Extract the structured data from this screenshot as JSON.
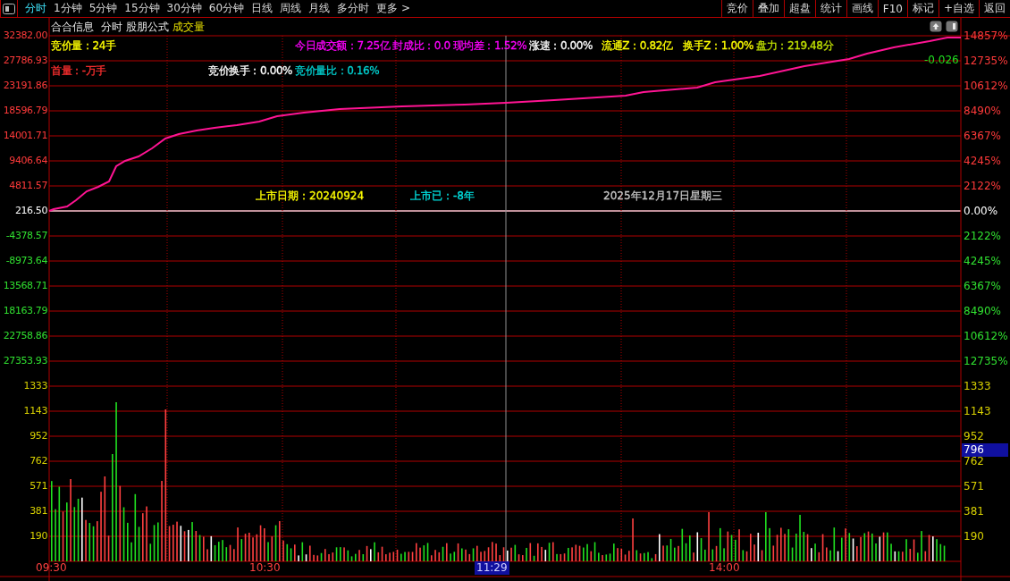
{
  "toolbar": {
    "tabs": [
      {
        "label": "分时",
        "selected": true
      },
      {
        "label": "1分钟",
        "selected": false
      },
      {
        "label": "5分钟",
        "selected": false
      },
      {
        "label": "15分钟",
        "selected": false
      },
      {
        "label": "30分钟",
        "selected": false
      },
      {
        "label": "60分钟",
        "selected": false
      },
      {
        "label": "日线",
        "selected": false
      },
      {
        "label": "周线",
        "selected": false
      },
      {
        "label": "月线",
        "selected": false
      },
      {
        "label": "多分时",
        "selected": false
      },
      {
        "label": "更多 >",
        "selected": false
      }
    ],
    "buttons": [
      "竞价",
      "叠加",
      "超盘",
      "统计",
      "画线",
      "F10",
      "标记",
      "+自选",
      "返回"
    ]
  },
  "chart_header": {
    "stock": "合合信息",
    "items": [
      {
        "label": "分时",
        "kind": "normal"
      },
      {
        "label": "股朋公式",
        "kind": "normal"
      },
      {
        "label": "成交量",
        "kind": "indicator"
      }
    ]
  },
  "info_row_1": [
    {
      "text": "竞价量：24手",
      "color": "#ffff00"
    },
    {
      "text": "今日成交额：7.25亿",
      "color": "#ff00ff"
    },
    {
      "text": "封成比：0.0",
      "color": "#ff00ff"
    },
    {
      "text": "现均差：1.52%",
      "color": "#ff00ff"
    },
    {
      "text": "涨速：0.00%",
      "color": "#ffffff"
    },
    {
      "text": "流通Z：0.82亿",
      "color": "#ffff00"
    },
    {
      "text": "换手Z：1.00%",
      "color": "#ffff00"
    },
    {
      "text": "盘力：219.48分",
      "color": "#c0e000"
    }
  ],
  "info_row_2": [
    {
      "text": "首量：-万手",
      "color": "#ff3030"
    },
    {
      "text": "竞价换手：0.00%",
      "color": "#ffffff"
    },
    {
      "text": "竞价量比：0.16%",
      "color": "#00d0d0"
    }
  ],
  "change_reading": "-0.026",
  "listing": [
    {
      "text": "上市日期：20240924",
      "color": "#ffff00"
    },
    {
      "text": "上市已：-8年",
      "color": "#00e0e0"
    },
    {
      "text": "2025年12月17日星期三",
      "color": "#c8c8c8"
    }
  ],
  "left_axis": [
    {
      "label": "32382.00",
      "kind": "up"
    },
    {
      "label": "27786.93",
      "kind": "up"
    },
    {
      "label": "23191.86",
      "kind": "up"
    },
    {
      "label": "18596.79",
      "kind": "up"
    },
    {
      "label": "14001.71",
      "kind": "up"
    },
    {
      "label": "9406.64",
      "kind": "up"
    },
    {
      "label": "4811.57",
      "kind": "up"
    },
    {
      "label": "216.50",
      "kind": "flat"
    },
    {
      "label": "-4378.57",
      "kind": "down"
    },
    {
      "label": "-8973.64",
      "kind": "down"
    },
    {
      "label": "13568.71",
      "kind": "down"
    },
    {
      "label": "18163.79",
      "kind": "down"
    },
    {
      "label": "22758.86",
      "kind": "down"
    },
    {
      "label": "27353.93",
      "kind": "down"
    },
    {
      "label": "1333",
      "kind": "volume"
    },
    {
      "label": "1143",
      "kind": "volume"
    },
    {
      "label": "952",
      "kind": "volume"
    },
    {
      "label": "762",
      "kind": "volume"
    },
    {
      "label": "571",
      "kind": "volume"
    },
    {
      "label": "381",
      "kind": "volume"
    },
    {
      "label": "190",
      "kind": "volume"
    }
  ],
  "right_axis": [
    {
      "label": "14857%",
      "kind": "up"
    },
    {
      "label": "12735%",
      "kind": "up"
    },
    {
      "label": "10612%",
      "kind": "up"
    },
    {
      "label": "8490%",
      "kind": "up"
    },
    {
      "label": "6367%",
      "kind": "up"
    },
    {
      "label": "4245%",
      "kind": "up"
    },
    {
      "label": "2122%",
      "kind": "up"
    },
    {
      "label": "0.00%",
      "kind": "flat"
    },
    {
      "label": "2122%",
      "kind": "down"
    },
    {
      "label": "4245%",
      "kind": "down"
    },
    {
      "label": "6367%",
      "kind": "down"
    },
    {
      "label": "8490%",
      "kind": "down"
    },
    {
      "label": "10612%",
      "kind": "down"
    },
    {
      "label": "12735%",
      "kind": "down"
    },
    {
      "label": "1333",
      "kind": "volume"
    },
    {
      "label": "1143",
      "kind": "volume"
    },
    {
      "label": "952",
      "kind": "volume"
    },
    {
      "label": "762",
      "kind": "volume"
    },
    {
      "label": "571",
      "kind": "volume"
    },
    {
      "label": "381",
      "kind": "volume"
    },
    {
      "label": "190",
      "kind": "volume"
    }
  ],
  "cursor_value": "796",
  "time_axis": [
    {
      "label": "09:30",
      "kind": "normal"
    },
    {
      "label": "10:30",
      "kind": "normal"
    },
    {
      "label": "11:29",
      "kind": "cursor"
    },
    {
      "label": "14:00",
      "kind": "normal"
    }
  ]
}
